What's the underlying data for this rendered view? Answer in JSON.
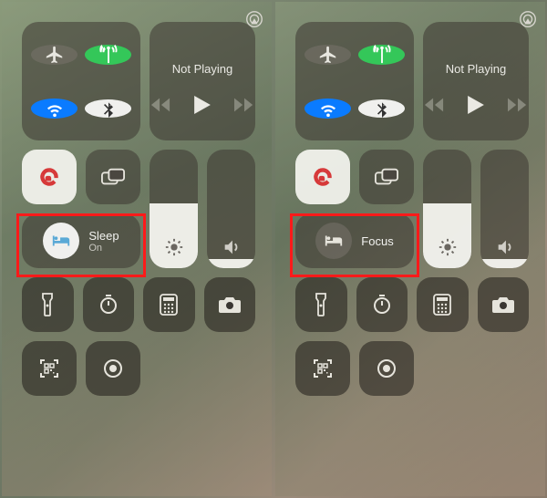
{
  "left": {
    "media_title": "Not Playing",
    "focus_label": "Sleep",
    "focus_sub": "On",
    "focus_active": true,
    "brightness_pct": 55,
    "volume_pct": 8
  },
  "right": {
    "media_title": "Not Playing",
    "focus_label": "Focus",
    "focus_sub": "",
    "focus_active": false,
    "brightness_pct": 55,
    "volume_pct": 8
  },
  "colors": {
    "highlight": "#ff1a1a",
    "blue": "#0a7bff"
  }
}
